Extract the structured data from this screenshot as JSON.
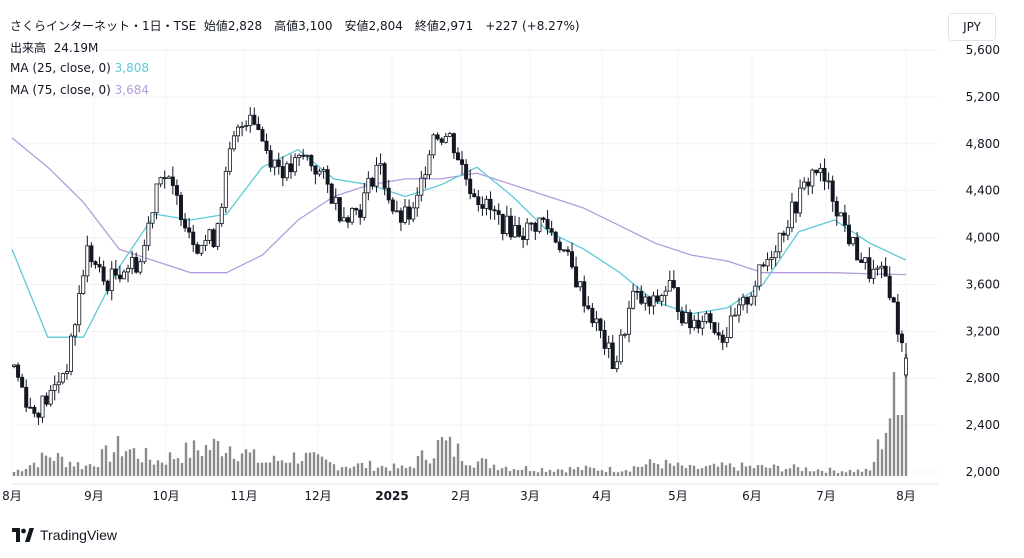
{
  "legend": {
    "header": "さくらインターネット・1日・TSE",
    "ohlc": "始値2,828　高値3,100　安値2,804　終値2,971　+227 (+8.27%)",
    "volume_label": "出来高",
    "volume_value": "24.19M",
    "ma25_label": "MA (25, close, 0)",
    "ma25_value": "3,808",
    "ma75_label": "MA (75, close, 0)",
    "ma75_value": "3,684"
  },
  "currency": "JPY",
  "brand": {
    "name": "TradingView",
    "icon": "tradingview-logo-icon"
  },
  "colors": {
    "candle": "#131722",
    "volume": "#8a8a8a",
    "ma25": "#5ccbd6",
    "ma75": "#b39ddb",
    "axis_text": "#131722",
    "grid": "#f0f3fa"
  },
  "chart_data": {
    "type": "candlestick",
    "y_ticks": [
      "5,600",
      "5,200",
      "4,800",
      "4,400",
      "4,000",
      "3,600",
      "3,200",
      "2,800",
      "2,400",
      "2,000"
    ],
    "ylim": [
      2000,
      5600
    ],
    "x_ticks": [
      "8月",
      "9月",
      "10月",
      "11月",
      "12月",
      "2025",
      "2月",
      "3月",
      "4月",
      "5月",
      "6月",
      "7月",
      "8月"
    ],
    "price_path": [
      [
        "8月",
        2900
      ],
      [
        "8月",
        2500
      ],
      [
        "8月",
        2650
      ],
      [
        "8月",
        2950
      ],
      [
        "9月",
        3900
      ],
      [
        "9月",
        3600
      ],
      [
        "9月",
        3750
      ],
      [
        "9月",
        3800
      ],
      [
        "10月",
        4600
      ],
      [
        "10月",
        4300
      ],
      [
        "10月",
        3950
      ],
      [
        "10月",
        4000
      ],
      [
        "11月",
        4800
      ],
      [
        "11月",
        5100
      ],
      [
        "11月",
        4700
      ],
      [
        "11月",
        4550
      ],
      [
        "12月",
        4700
      ],
      [
        "12月",
        4500
      ],
      [
        "12月",
        4200
      ],
      [
        "12月",
        4250
      ],
      [
        "2025",
        4650
      ],
      [
        "2025",
        4150
      ],
      [
        "2025",
        4200
      ],
      [
        "2025",
        4900
      ],
      [
        "2月",
        4850
      ],
      [
        "2月",
        4450
      ],
      [
        "2月",
        4250
      ],
      [
        "2月",
        4100
      ],
      [
        "3月",
        4050
      ],
      [
        "3月",
        4150
      ],
      [
        "3月",
        3950
      ],
      [
        "3月",
        3600
      ],
      [
        "4月",
        3250
      ],
      [
        "4月",
        2900
      ],
      [
        "4月",
        3500
      ],
      [
        "4月",
        3400
      ],
      [
        "5月",
        3600
      ],
      [
        "5月",
        3250
      ],
      [
        "5月",
        3350
      ],
      [
        "5月",
        3150
      ],
      [
        "6月",
        3400
      ],
      [
        "6月",
        3700
      ],
      [
        "6月",
        4000
      ],
      [
        "6月",
        4300
      ],
      [
        "7月",
        4600
      ],
      [
        "7月",
        4350
      ],
      [
        "7月",
        3950
      ],
      [
        "7月",
        3700
      ],
      [
        "8月",
        3650
      ],
      [
        "8月",
        2900
      ]
    ],
    "volume_path": [
      [
        "8月",
        0.9
      ],
      [
        "8月",
        4.5
      ],
      [
        "9月",
        2.1
      ],
      [
        "9月",
        6.4
      ],
      [
        "10月",
        3.2
      ],
      [
        "10月",
        5.6
      ],
      [
        "11月",
        7.1
      ],
      [
        "11月",
        2.9
      ],
      [
        "12月",
        4.4
      ],
      [
        "12月",
        2.4
      ],
      [
        "2025",
        2.3
      ],
      [
        "2025",
        1.6
      ],
      [
        "2月",
        7.2
      ],
      [
        "2月",
        3.1
      ],
      [
        "3月",
        1.8
      ],
      [
        "3月",
        1.5
      ],
      [
        "4月",
        1.6
      ],
      [
        "4月",
        1.4
      ],
      [
        "5月",
        2.9
      ],
      [
        "5月",
        1.6
      ],
      [
        "6月",
        2.1
      ],
      [
        "6月",
        1.9
      ],
      [
        "7月",
        1.7
      ],
      [
        "7月",
        1.2
      ],
      [
        "8月",
        1.1
      ],
      [
        "8月",
        24.19
      ]
    ],
    "ma25_path": [
      [
        "8月",
        3900
      ],
      [
        "8月",
        3150
      ],
      [
        "9月",
        3150
      ],
      [
        "9月",
        3750
      ],
      [
        "10月",
        4200
      ],
      [
        "10月",
        4150
      ],
      [
        "11月",
        4200
      ],
      [
        "11月",
        4600
      ],
      [
        "12月",
        4750
      ],
      [
        "12月",
        4500
      ],
      [
        "2025",
        4450
      ],
      [
        "2025",
        4350
      ],
      [
        "2月",
        4450
      ],
      [
        "2月",
        4600
      ],
      [
        "3月",
        4350
      ],
      [
        "3月",
        4050
      ],
      [
        "4月",
        3900
      ],
      [
        "4月",
        3700
      ],
      [
        "5月",
        3450
      ],
      [
        "5月",
        3350
      ],
      [
        "6月",
        3400
      ],
      [
        "6月",
        3600
      ],
      [
        "7月",
        4050
      ],
      [
        "7月",
        4150
      ],
      [
        "8月",
        3950
      ],
      [
        "8月",
        3808
      ]
    ],
    "ma75_path": [
      [
        "8月",
        4850
      ],
      [
        "8月",
        4600
      ],
      [
        "9月",
        4300
      ],
      [
        "9月",
        3900
      ],
      [
        "10月",
        3800
      ],
      [
        "10月",
        3700
      ],
      [
        "11月",
        3700
      ],
      [
        "11月",
        3850
      ],
      [
        "12月",
        4150
      ],
      [
        "12月",
        4350
      ],
      [
        "2025",
        4450
      ],
      [
        "2025",
        4500
      ],
      [
        "2月",
        4500
      ],
      [
        "2月",
        4550
      ],
      [
        "3月",
        4450
      ],
      [
        "3月",
        4350
      ],
      [
        "4月",
        4250
      ],
      [
        "4月",
        4100
      ],
      [
        "5月",
        3950
      ],
      [
        "5月",
        3850
      ],
      [
        "6月",
        3800
      ],
      [
        "6月",
        3700
      ],
      [
        "7月",
        3700
      ],
      [
        "7月",
        3700
      ],
      [
        "8月",
        3690
      ],
      [
        "8月",
        3684
      ]
    ],
    "last": {
      "open": 2828,
      "high": 3100,
      "low": 2804,
      "close": 2971
    }
  }
}
